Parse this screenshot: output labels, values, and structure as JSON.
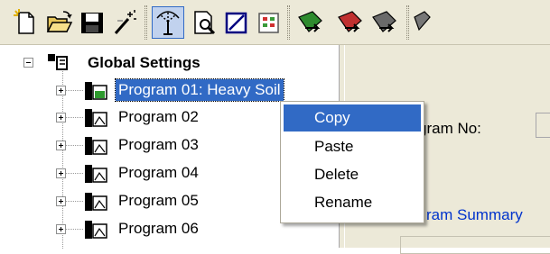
{
  "toolbar": {
    "buttons": [
      {
        "name": "new-icon"
      },
      {
        "name": "open-folder-icon"
      },
      {
        "name": "save-icon"
      },
      {
        "name": "magic-wand-icon"
      },
      {
        "name": "sprinkler-icon",
        "active": true
      },
      {
        "name": "print-preview-icon"
      },
      {
        "name": "edit-box-icon"
      },
      {
        "name": "grid-icon"
      },
      {
        "name": "send-green-icon"
      },
      {
        "name": "send-red-icon"
      },
      {
        "name": "send-gray-icon"
      }
    ]
  },
  "tree": {
    "root": {
      "label": "Global Settings",
      "icon": "global-settings-icon"
    },
    "programs": [
      {
        "label": "Program 01: Heavy Soil",
        "selected": true
      },
      {
        "label": "Program 02"
      },
      {
        "label": "Program 03"
      },
      {
        "label": "Program 04"
      },
      {
        "label": "Program 05"
      },
      {
        "label": "Program 06"
      }
    ]
  },
  "right_pane": {
    "program_no_label": "gram No:",
    "program_summary_link": "ram Summary"
  },
  "context_menu": {
    "items": [
      {
        "label": "Copy",
        "highlighted": true
      },
      {
        "label": "Paste"
      },
      {
        "label": "Delete"
      },
      {
        "label": "Rename"
      }
    ]
  },
  "colors": {
    "selection": "#316ac5",
    "face": "#ece9d8",
    "link": "#0033cc"
  }
}
